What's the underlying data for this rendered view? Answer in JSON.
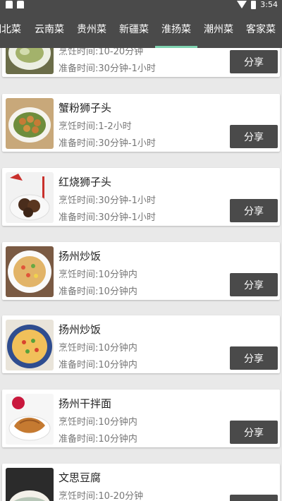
{
  "status_bar": {
    "time": "3:54",
    "icons": [
      "notification-icon",
      "notification-icon",
      "wifi-icon",
      "battery-icon"
    ]
  },
  "tabs": [
    {
      "label": "湖北菜",
      "active": false
    },
    {
      "label": "云南菜",
      "active": false
    },
    {
      "label": "贵州菜",
      "active": false
    },
    {
      "label": "新疆菜",
      "active": false
    },
    {
      "label": "淮扬菜",
      "active": true
    },
    {
      "label": "潮州菜",
      "active": false
    },
    {
      "label": "客家菜",
      "active": false
    }
  ],
  "theme": {
    "dark": "#4a4a4a",
    "active_indicator": "#7ed3b0"
  },
  "recipes": [
    {
      "name": "",
      "cook_time": "烹饪时间:10-20分钟",
      "prep_time": "准备时间:30分钟-1小时",
      "share": "分享"
    },
    {
      "name": "蟹粉狮子头",
      "cook_time": "烹饪时间:1-2小时",
      "prep_time": "准备时间:30分钟-1小时",
      "share": "分享"
    },
    {
      "name": "红烧狮子头",
      "cook_time": "烹饪时间:30分钟-1小时",
      "prep_time": "准备时间:30分钟-1小时",
      "share": "分享"
    },
    {
      "name": "扬州炒饭",
      "cook_time": "烹饪时间:10分钟内",
      "prep_time": "准备时间:10分钟内",
      "share": "分享"
    },
    {
      "name": "扬州炒饭",
      "cook_time": "烹饪时间:10分钟内",
      "prep_time": "准备时间:10分钟内",
      "share": "分享"
    },
    {
      "name": "扬州干拌面",
      "cook_time": "烹饪时间:10分钟内",
      "prep_time": "准备时间:10分钟内",
      "share": "分享"
    },
    {
      "name": "文思豆腐",
      "cook_time": "烹饪时间:10-20分钟",
      "prep_time": "",
      "share": "分享"
    }
  ]
}
